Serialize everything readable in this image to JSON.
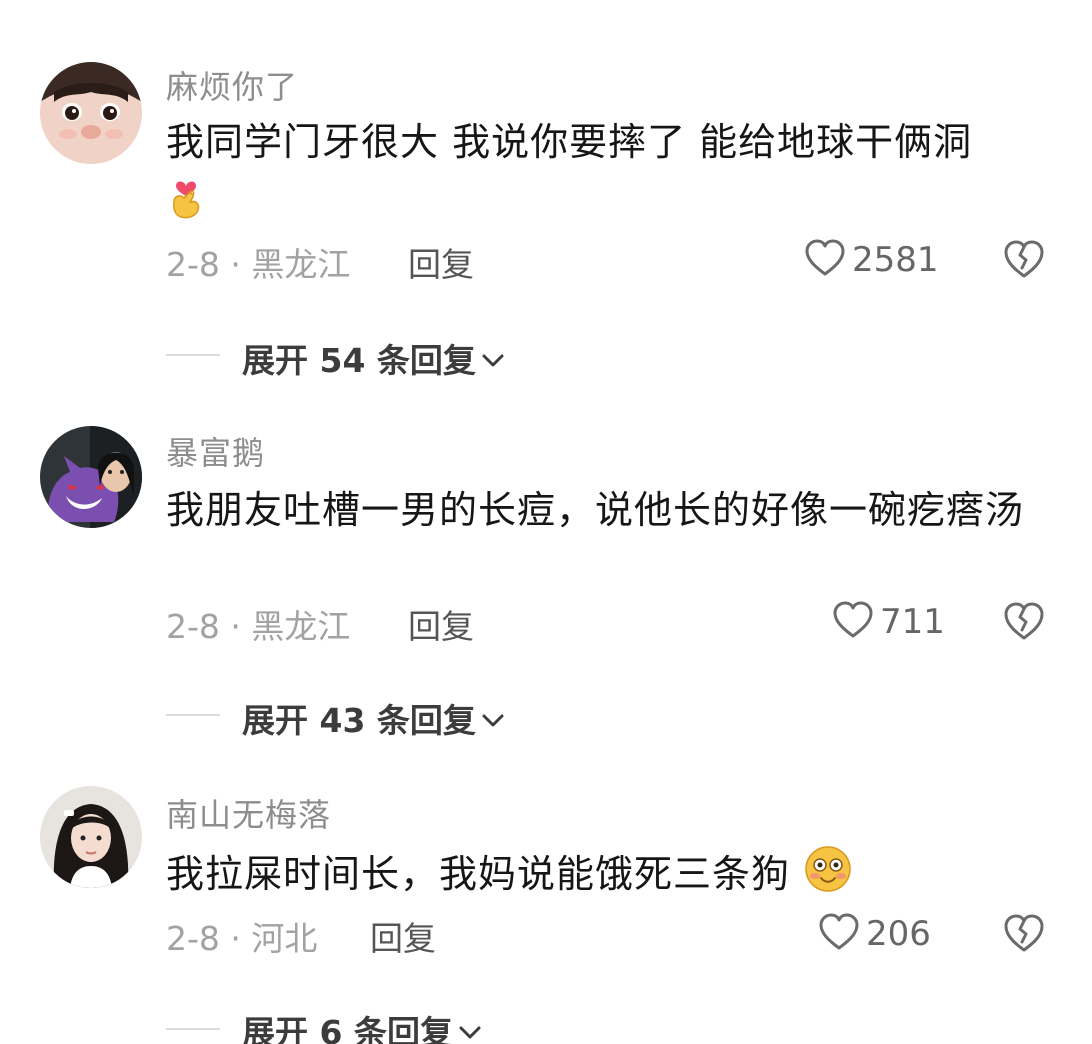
{
  "comments": [
    {
      "username": "麻烦你了",
      "text": "我同学门牙很大 我说你要摔了 能给地球干俩洞",
      "emoji": "finger-heart-emoji",
      "date_location": "2-8 · 黑龙江",
      "reply_label": "回复",
      "likes": "2581",
      "expand_label": "展开 54 条回复"
    },
    {
      "username": "暴富鹅",
      "text": "我朋友吐槽一男的长痘，说他长的好像一碗疙瘩汤",
      "date_location": "2-8 · 黑龙江",
      "reply_label": "回复",
      "likes": "711",
      "expand_label": "展开 43 条回复"
    },
    {
      "username": "南山无梅落",
      "text": "我拉屎时间长，我妈说能饿死三条狗",
      "emoji": "flushed-smile-emoji",
      "date_location": "2-8 · 河北",
      "reply_label": "回复",
      "likes": "206",
      "expand_label": "展开 6 条回复"
    }
  ],
  "icons": {
    "like": "heart-outline-icon",
    "dislike": "broken-heart-icon",
    "expand": "chevron-down-icon"
  },
  "colors": {
    "username": "#8d8d8d",
    "text": "#161616",
    "meta": "#a2a2a2",
    "icon": "#6b6b6b"
  }
}
